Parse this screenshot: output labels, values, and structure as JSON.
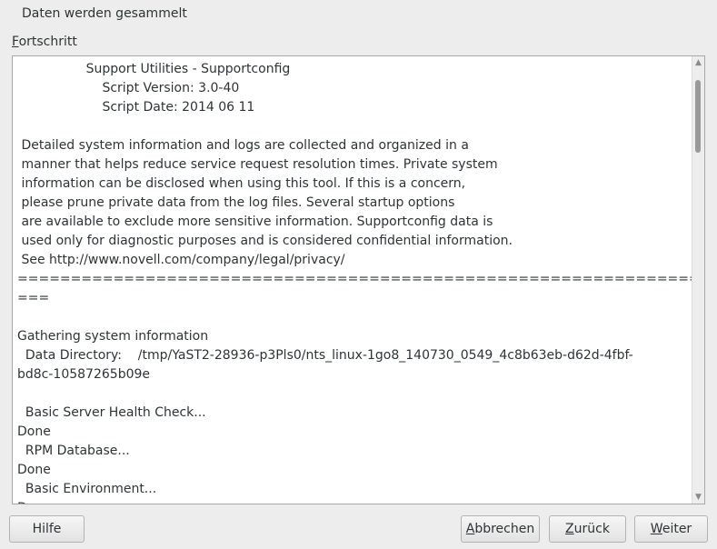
{
  "dialog": {
    "title": "Daten werden gesammelt"
  },
  "progress_group": {
    "label_mnemonic": "F",
    "label_rest": "ortschritt"
  },
  "log": {
    "lines": [
      "                 Support Utilities - Supportconfig",
      "                     Script Version: 3.0-40",
      "                     Script Date: 2014 06 11",
      "",
      " Detailed system information and logs are collected and organized in a",
      " manner that helps reduce service request resolution times. Private system",
      " information can be disclosed when using this tool. If this is a concern,",
      " please prune private data from the log files. Several startup options",
      " are available to exclude more sensitive information. Supportconfig data is",
      " used only for diagnostic purposes and is considered confidential information.",
      " See http://www.novell.com/company/legal/privacy/",
      "==============================================================================",
      "===",
      "",
      "Gathering system information",
      "  Data Directory:    /tmp/YaST2-28936-p3Pls0/nts_linux-1go8_140730_0549_4c8b63eb-d62d-4fbf-",
      "bd8c-10587265b09e",
      "",
      "  Basic Server Health Check...",
      "Done",
      "  RPM Database...",
      "Done",
      "  Basic Environment...",
      "Done"
    ]
  },
  "buttons": {
    "help": {
      "mnemonic": "",
      "rest": "Hilfe"
    },
    "abort": {
      "mnemonic": "A",
      "rest": "bbrechen"
    },
    "back": {
      "mnemonic": "Z",
      "rest": "urück"
    },
    "next": {
      "mnemonic": "W",
      "rest": "eiter"
    }
  },
  "icons": {
    "scroll_up": "scroll-up-arrow-icon",
    "scroll_down": "scroll-down-arrow-icon"
  }
}
